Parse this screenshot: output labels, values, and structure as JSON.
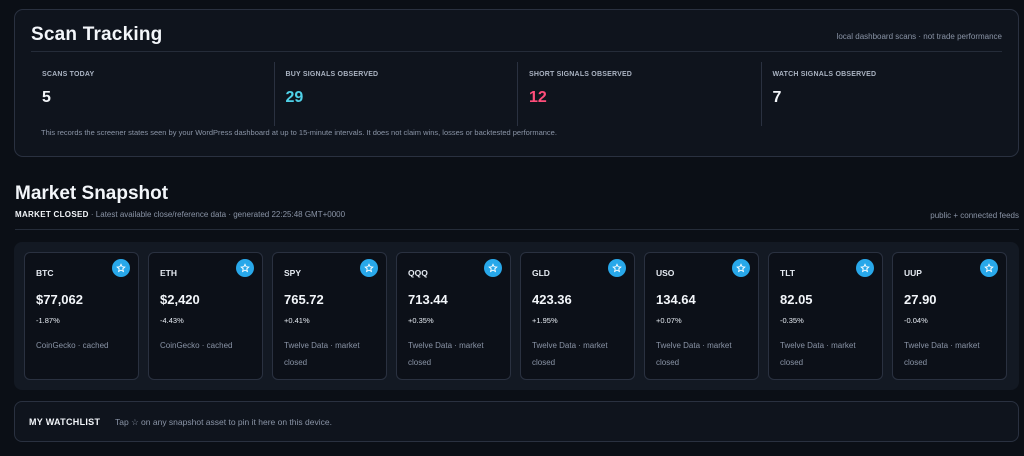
{
  "scan": {
    "title": "Scan Tracking",
    "note": "local dashboard scans · not trade performance",
    "stats": [
      {
        "label": "SCANS TODAY",
        "value": "5"
      },
      {
        "label": "BUY SIGNALS OBSERVED",
        "value": "29"
      },
      {
        "label": "SHORT SIGNALS OBSERVED",
        "value": "12"
      },
      {
        "label": "WATCH SIGNALS OBSERVED",
        "value": "7"
      }
    ],
    "footnote": "This records the screener states seen by your WordPress dashboard at up to 15-minute intervals. It does not claim wins, losses or backtested performance."
  },
  "market": {
    "title": "Market Snapshot",
    "status": "MARKET CLOSED",
    "subtitle": " · Latest available close/reference data · generated 22:25:48 GMT+0000",
    "feeds": "public + connected feeds",
    "tiles": [
      {
        "symbol": "BTC",
        "price": "$77,062",
        "change": "-1.87%",
        "source": "CoinGecko · cached"
      },
      {
        "symbol": "ETH",
        "price": "$2,420",
        "change": "-4.43%",
        "source": "CoinGecko · cached"
      },
      {
        "symbol": "SPY",
        "price": "765.72",
        "change": "+0.41%",
        "source": "Twelve Data · market closed"
      },
      {
        "symbol": "QQQ",
        "price": "713.44",
        "change": "+0.35%",
        "source": "Twelve Data · market closed"
      },
      {
        "symbol": "GLD",
        "price": "423.36",
        "change": "+1.95%",
        "source": "Twelve Data · market closed"
      },
      {
        "symbol": "USO",
        "price": "134.64",
        "change": "+0.07%",
        "source": "Twelve Data · market closed"
      },
      {
        "symbol": "TLT",
        "price": "82.05",
        "change": "-0.35%",
        "source": "Twelve Data · market closed"
      },
      {
        "symbol": "UUP",
        "price": "27.90",
        "change": "-0.04%",
        "source": "Twelve Data · market closed"
      }
    ],
    "star_icon": "star-icon",
    "star_color": "#28a8ea"
  },
  "watchlist": {
    "title": "MY WATCHLIST",
    "text": "Tap ☆ on any snapshot asset to pin it here on this device."
  }
}
